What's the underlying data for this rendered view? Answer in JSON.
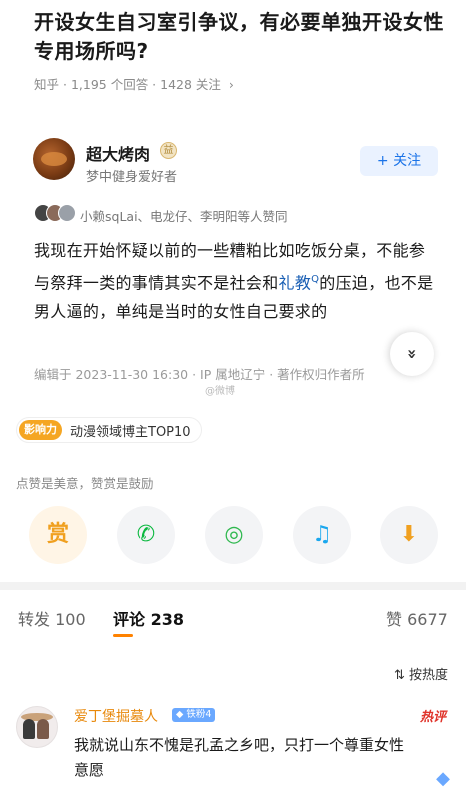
{
  "question": {
    "title": "开设女生自习室引争议，有必要单独开设女性专用场所吗?",
    "source": "知乎",
    "answers": "1,195 个回答",
    "follows": "1428 关注",
    "chevron": "›"
  },
  "author": {
    "name": "超大烤肉",
    "subtitle": "梦中健身爱好者",
    "follow_label": "+ 关注",
    "badge_glyph": "益"
  },
  "likers": {
    "text": "小赖sqLai、电龙仔、李明阳等人赞同",
    "avatar_colors": [
      "#444444",
      "#8a6a5a",
      "#9aa0a8"
    ]
  },
  "answer": {
    "text_before": "我现在开始怀疑以前的一些糟粕比如吃饭分桌，不能参与祭拜一类的事情其实不是社会和",
    "link_text": "礼教",
    "search_mark": "Q",
    "text_after": "的压迫，也不是男人逼的，单纯是当时的女性自己要求的",
    "expand_glyph": "»",
    "edit_meta": "编辑于 2023-11-30 16:30 · IP 属地辽宁 · 著作权归作者所",
    "watermark": "@微博"
  },
  "influence": {
    "tag": "影响力",
    "text": "动漫领域博主TOP10"
  },
  "tip": "点赞是美意，赞赏是鼓励",
  "actions": [
    {
      "name": "reward",
      "glyph": "赏"
    },
    {
      "name": "wechat",
      "glyph": "✆"
    },
    {
      "name": "moments",
      "glyph": "◎"
    },
    {
      "name": "qq",
      "glyph": "♫"
    },
    {
      "name": "save-image",
      "glyph": "⬇"
    }
  ],
  "tabs": {
    "repost_label": "转发 100",
    "comment_label": "评论 238",
    "like_label": "赞 6677"
  },
  "sort_label": "⇅ 按热度",
  "comment": {
    "name": "爱丁堡掘墓人",
    "badge": "◆ 铁粉4",
    "hot_tag": "热评",
    "text": "我就说山东不愧是孔孟之乡吧，只打一个尊重女性意愿",
    "sparkle_glyph": "◆"
  },
  "colors": {
    "accent_blue": "#1a73e8",
    "tab_underline": "#ff8200",
    "hot_red": "#e0332a",
    "comment_name": "#e8890c"
  }
}
